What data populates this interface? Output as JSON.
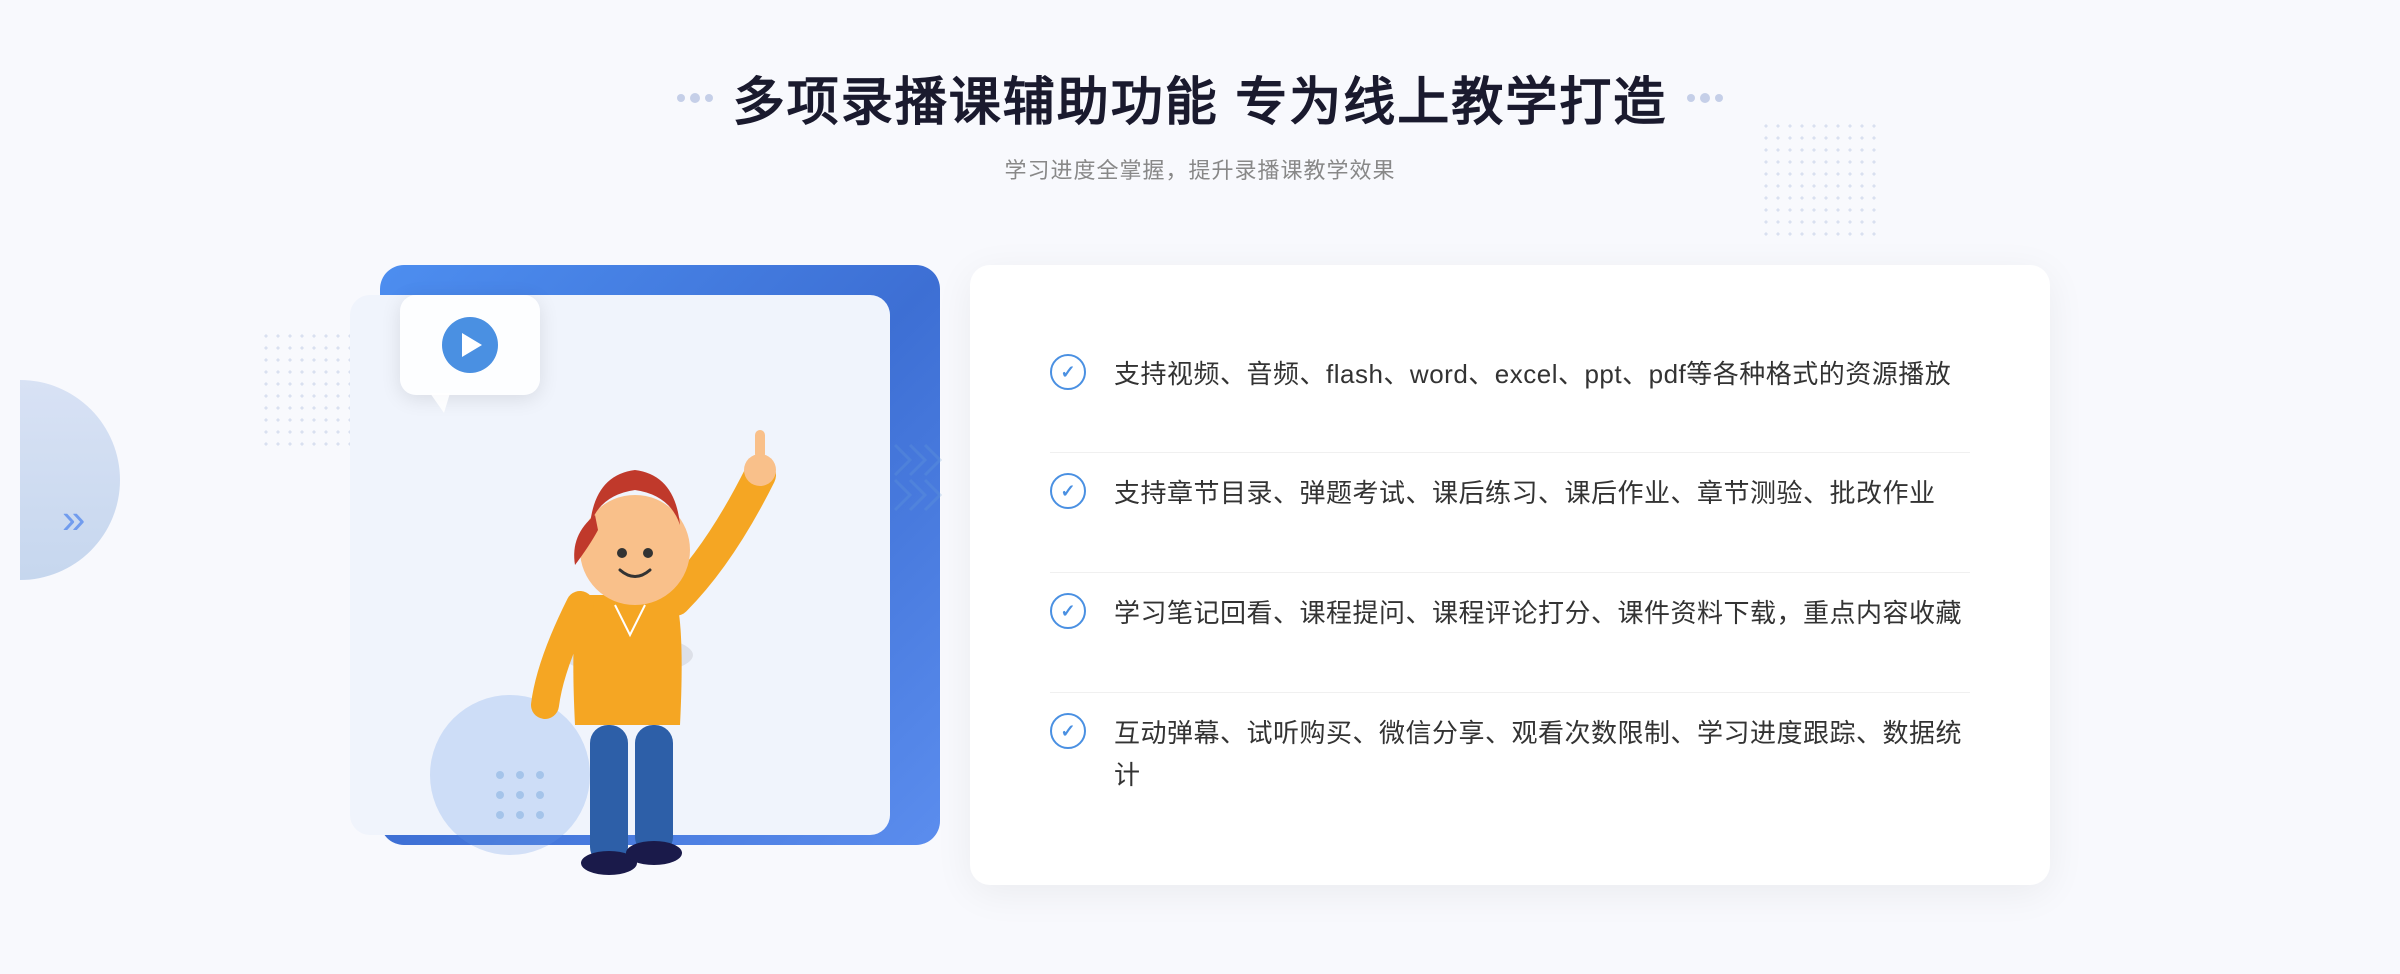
{
  "page": {
    "background": "#f8f9fd"
  },
  "header": {
    "title": "多项录播课辅助功能 专为线上教学打造",
    "subtitle": "学习进度全掌握，提升录播课教学效果"
  },
  "features": [
    {
      "id": "feature-1",
      "text": "支持视频、音频、flash、word、excel、ppt、pdf等各种格式的资源播放"
    },
    {
      "id": "feature-2",
      "text": "支持章节目录、弹题考试、课后练习、课后作业、章节测验、批改作业"
    },
    {
      "id": "feature-3",
      "text": "学习笔记回看、课程提问、课程评论打分、课件资料下载，重点内容收藏"
    },
    {
      "id": "feature-4",
      "text": "互动弹幕、试听购买、微信分享、观看次数限制、学习进度跟踪、数据统计"
    }
  ],
  "decorative": {
    "chevron": "»",
    "dot_grid_label": "dot-grid-decoration"
  }
}
